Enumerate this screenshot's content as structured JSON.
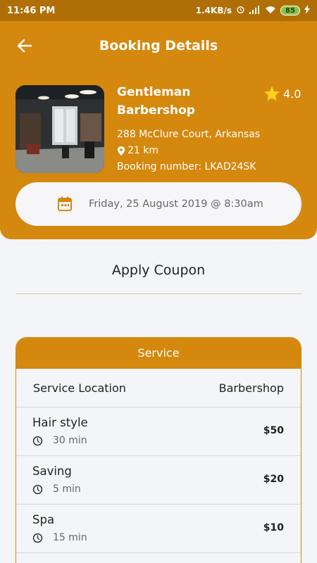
{
  "status_bar": {
    "time": "11:46 PM",
    "network_speed": "1.4KB/s",
    "battery": "85"
  },
  "header": {
    "title": "Booking Details"
  },
  "shop": {
    "name": "Gentleman Barbershop",
    "rating": "4.0",
    "address": "288 McClure Court, Arkansas",
    "distance": "21 km",
    "booking_number": "Booking number: LKAD24SK"
  },
  "booking": {
    "datetime": "Friday, 25 August 2019 @ 8:30am"
  },
  "coupon": {
    "label": "Apply Coupon"
  },
  "service": {
    "header": "Service",
    "location_label": "Service Location",
    "location_value": "Barbershop",
    "items": [
      {
        "name": "Hair style",
        "duration": "30 min",
        "price": "$50"
      },
      {
        "name": "Saving",
        "duration": "5 min",
        "price": "$20"
      },
      {
        "name": "Spa",
        "duration": "15 min",
        "price": "$10"
      }
    ]
  },
  "colors": {
    "primary": "#d4880e",
    "status_bar": "#b06f06",
    "background": "#f4f5f9"
  }
}
